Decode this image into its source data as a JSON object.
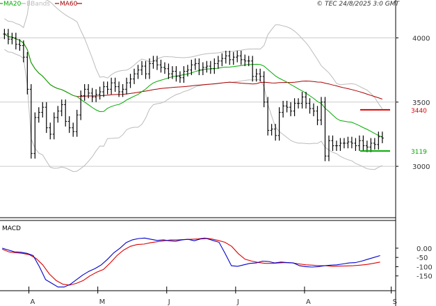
{
  "legend": [
    {
      "label": "MA20",
      "color": "#00aa00"
    },
    {
      "label": "BBands",
      "color": "#bbbbbb"
    },
    {
      "label": "MA60",
      "color": "#aa0000"
    }
  ],
  "copyright": "© TEC 24/8/2025 3:0 GMT",
  "macd_label": "MACD",
  "colors": {
    "price": "#000000",
    "ma20": "#00aa00",
    "bbands": "#bbbbbb",
    "ma60": "#aa0000",
    "macd": "#0000cc",
    "signal": "#dd0000",
    "gridline": "#cccccc",
    "panel_border": "#000000"
  },
  "chart_data": [
    {
      "type": "ohlc",
      "panel": "price",
      "ylim": [
        2600,
        4230
      ],
      "y_ticks": [
        {
          "value": 4000,
          "label": "4000"
        },
        {
          "value": 3500,
          "label": "3500"
        },
        {
          "value": 3000,
          "label": "3000"
        }
      ],
      "x_ticks": [
        {
          "label": "A",
          "day": 8
        },
        {
          "label": "M",
          "day": 39
        },
        {
          "label": "J",
          "day": 70
        },
        {
          "label": "J",
          "day": 101
        },
        {
          "label": "A",
          "day": 132
        },
        {
          "label": "S",
          "day": 171
        }
      ],
      "x_range": [
        -5,
        173
      ],
      "levels": [
        {
          "label": "3440",
          "value": 3440,
          "color": "#dd0000"
        },
        {
          "label": "3119",
          "value": 3119,
          "color": "#00aa00"
        }
      ],
      "close": [
        4030,
        3990,
        4000,
        3950,
        3940,
        3850,
        3600,
        3100,
        3380,
        3420,
        3460,
        3300,
        3250,
        3380,
        3430,
        3480,
        3350,
        3300,
        3270,
        3400,
        3550,
        3600,
        3570,
        3540,
        3560,
        3580,
        3620,
        3600,
        3650,
        3620,
        3580,
        3600,
        3650,
        3680,
        3720,
        3750,
        3780,
        3720,
        3800,
        3820,
        3790,
        3770,
        3760,
        3720,
        3740,
        3700,
        3690,
        3740,
        3750,
        3790,
        3800,
        3750,
        3770,
        3780,
        3760,
        3800,
        3820,
        3840,
        3860,
        3830,
        3850,
        3860,
        3830,
        3820,
        3820,
        3700,
        3720,
        3700,
        3500,
        3280,
        3290,
        3240,
        3420,
        3470,
        3460,
        3430,
        3490,
        3490,
        3540,
        3490,
        3450,
        3430,
        3360,
        3500,
        3080,
        3200,
        3160,
        3160,
        3180,
        3180,
        3190,
        3180,
        3160,
        3200,
        3160,
        3150,
        3180,
        3170,
        3230,
        3220
      ]
    },
    {
      "type": "line",
      "panel": "macd",
      "ylim": [
        -230,
        150
      ],
      "y_ticks": [
        {
          "value": 0,
          "label": "0.00"
        },
        {
          "value": -50,
          "label": "-50"
        },
        {
          "value": -100,
          "label": "-100"
        },
        {
          "value": -150,
          "label": "-150"
        }
      ],
      "series": [
        {
          "name": "MACD",
          "values": [
            0,
            -10,
            -20,
            -22,
            -28,
            -40,
            -100,
            -170,
            -190,
            -210,
            -210,
            -195,
            -170,
            -145,
            -125,
            -110,
            -90,
            -60,
            -25,
            0,
            30,
            45,
            52,
            55,
            48,
            42,
            45,
            40,
            38,
            45,
            48,
            40,
            50,
            52,
            42,
            32,
            -30,
            -95,
            -98,
            -90,
            -82,
            -80,
            -70,
            -72,
            -80,
            -75,
            -78,
            -80,
            -95,
            -100,
            -102,
            -100,
            -95,
            -92,
            -90,
            -85,
            -80,
            -78,
            -70,
            -60,
            -50,
            -40
          ]
        },
        {
          "name": "Signal",
          "values": [
            -5,
            -20,
            -25,
            -28,
            -35,
            -55,
            -90,
            -140,
            -175,
            -195,
            -200,
            -190,
            -175,
            -150,
            -130,
            -115,
            -80,
            -40,
            -10,
            10,
            20,
            22,
            30,
            35,
            40,
            45,
            45,
            47,
            48,
            50,
            55,
            50,
            42,
            32,
            10,
            -30,
            -60,
            -70,
            -78,
            -82,
            -82,
            -80,
            -78,
            -80,
            -85,
            -90,
            -92,
            -95,
            -95,
            -98,
            -97,
            -96,
            -95,
            -92,
            -88,
            -82,
            -75
          ]
        }
      ]
    }
  ]
}
